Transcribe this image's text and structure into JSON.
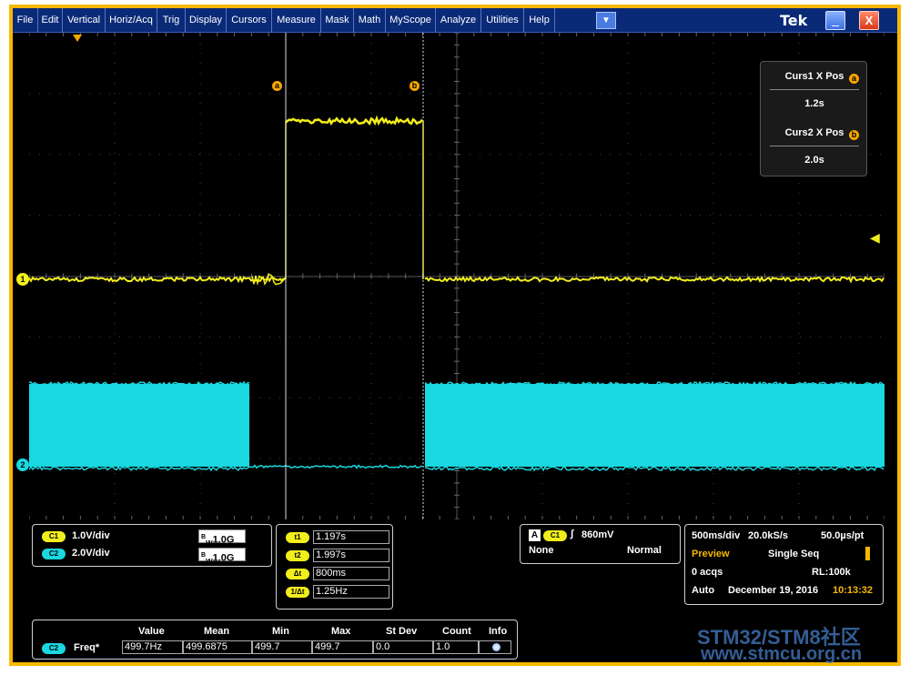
{
  "menu": {
    "items": [
      "File",
      "Edit",
      "Vertical",
      "Horiz/Acq",
      "Trig",
      "Display",
      "Cursors",
      "Measure",
      "Mask",
      "Math",
      "MyScope",
      "Analyze",
      "Utilities",
      "Help"
    ],
    "dropdown_icon": "dropdown-arrow-icon",
    "brand": "Tek",
    "minimize_glyph": "_",
    "close_glyph": "X"
  },
  "cursors": {
    "a_label": "a",
    "b_label": "b",
    "curs1_title": "Curs1 X Pos",
    "curs1_value": "1.2s",
    "curs2_title": "Curs2 X Pos",
    "curs2_value": "2.0s"
  },
  "channels": {
    "ch1_marker": "1",
    "ch2_marker": "2",
    "ch1_color": "#f2ee1c",
    "ch2_color": "#19d8e0",
    "accent_color": "#f7b900"
  },
  "vertical": {
    "c1_tag": "C1",
    "c1_scale": "1.0V/div",
    "c1_bw": "1.0G",
    "c2_tag": "C2",
    "c2_scale": "2.0V/div",
    "c2_bw": "1.0G",
    "bw_prefix": "B",
    "bw_sub": "W"
  },
  "cursor_readout": {
    "t1_tag": "t1",
    "t1": "1.197s",
    "t2_tag": "t2",
    "t2": "1.997s",
    "dt_tag": "Δt",
    "dt": "800ms",
    "inv_tag": "1/Δt",
    "inv": "1.25Hz"
  },
  "trigger": {
    "a_tag": "A",
    "source_tag": "C1",
    "level": "860mV",
    "coupling": "None",
    "mode": "Normal"
  },
  "acquisition": {
    "timebase": "500ms/div",
    "sample_rate": "20.0kS/s",
    "resolution": "50.0µs/pt",
    "state": "Preview",
    "mode": "Single Seq",
    "acqs": "0 acqs",
    "record_length": "RL:100k",
    "auto": "Auto",
    "date": "December 19, 2016",
    "time": "10:13:32"
  },
  "measurements": {
    "headers": [
      "Value",
      "Mean",
      "Min",
      "Max",
      "St Dev",
      "Count",
      "Info"
    ],
    "row": {
      "source": "C2",
      "name": "Freq*",
      "value": "499.7Hz",
      "mean": "499.6875",
      "min": "499.7",
      "max": "499.7",
      "stdev": "0.0",
      "count": "1.0"
    }
  },
  "watermark": {
    "line1": "STM32/STM8社区",
    "line2": "www.stmcu.org.cn"
  }
}
